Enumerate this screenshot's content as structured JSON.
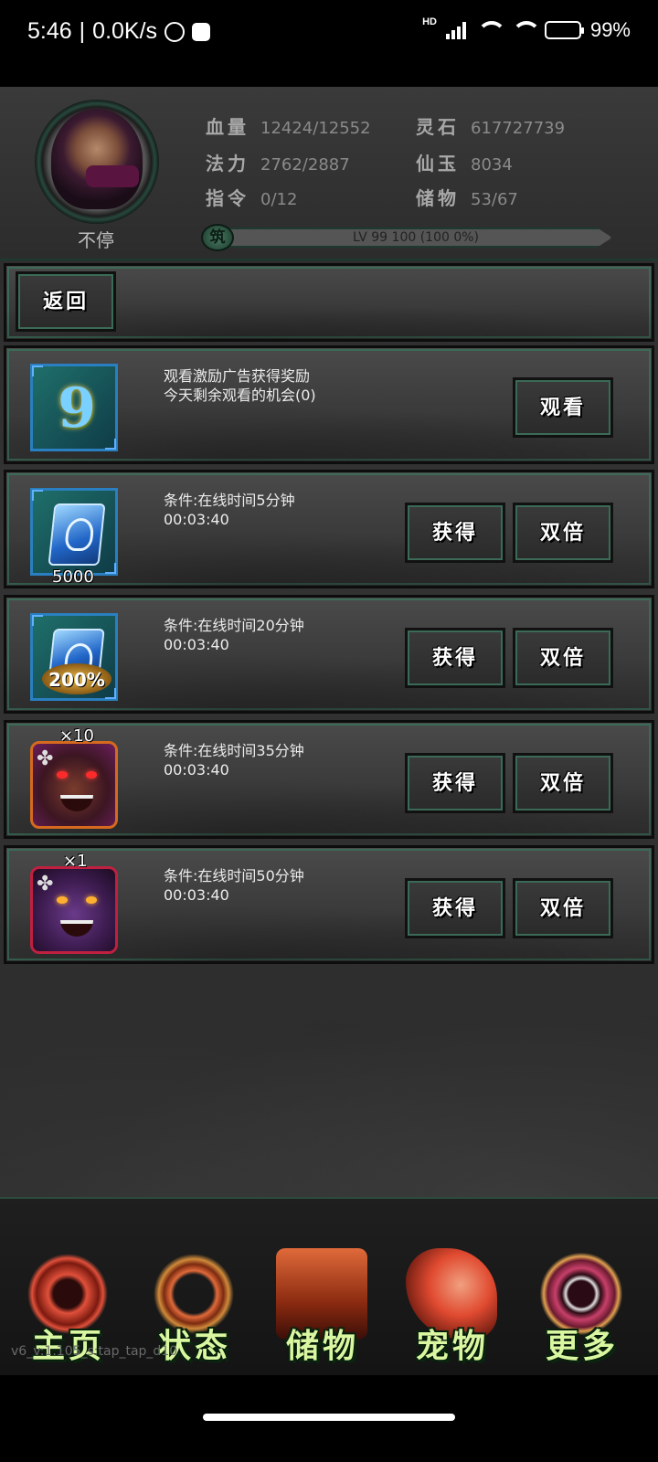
{
  "status_bar": {
    "time": "5:46",
    "speed": "0.0K/s",
    "network_label": "HD",
    "battery": "99%"
  },
  "header": {
    "avatar_status": "不停",
    "stats": [
      {
        "label": "血量",
        "value": "12424/12552"
      },
      {
        "label": "灵石",
        "value": "617727739"
      },
      {
        "label": "法力",
        "value": "2762/2887"
      },
      {
        "label": "仙玉",
        "value": "8034"
      },
      {
        "label": "指令",
        "value": "0/12"
      },
      {
        "label": "储物",
        "value": "53/67"
      }
    ],
    "level_badge": "筑",
    "level_text": "LV 99 100 (100 0%)"
  },
  "back_panel": {
    "back_label": "返回"
  },
  "ad_panel": {
    "line1": "观看激励广告获得奖励",
    "line2": "今天剩余观看的机会(0)",
    "watch_label": "观看"
  },
  "rewards": [
    {
      "condition": "条件:在线时间5分钟",
      "timer": "00:03:40",
      "qty": "5000",
      "get_label": "获得",
      "double_label": "双倍"
    },
    {
      "condition": "条件:在线时间20分钟",
      "timer": "00:03:40",
      "badge": "200%",
      "get_label": "获得",
      "double_label": "双倍"
    },
    {
      "condition": "条件:在线时间35分钟",
      "timer": "00:03:40",
      "qty": "×10",
      "get_label": "获得",
      "double_label": "双倍"
    },
    {
      "condition": "条件:在线时间50分钟",
      "timer": "00:03:40",
      "qty": "×1",
      "get_label": "获得",
      "double_label": "双倍"
    }
  ],
  "nav": [
    {
      "label": "主页",
      "icon": "home-emblem-icon",
      "color": "#e0503a"
    },
    {
      "label": "状态",
      "icon": "status-emblem-icon",
      "color": "#e06a3a"
    },
    {
      "label": "储物",
      "icon": "storage-emblem-icon",
      "color": "#d8502a"
    },
    {
      "label": "宠物",
      "icon": "pet-emblem-icon",
      "color": "#e04a30"
    },
    {
      "label": "更多",
      "icon": "more-emblem-icon",
      "color": "#c8406a"
    }
  ],
  "version": "v6_v:1.105_s:tap_tap_d10"
}
